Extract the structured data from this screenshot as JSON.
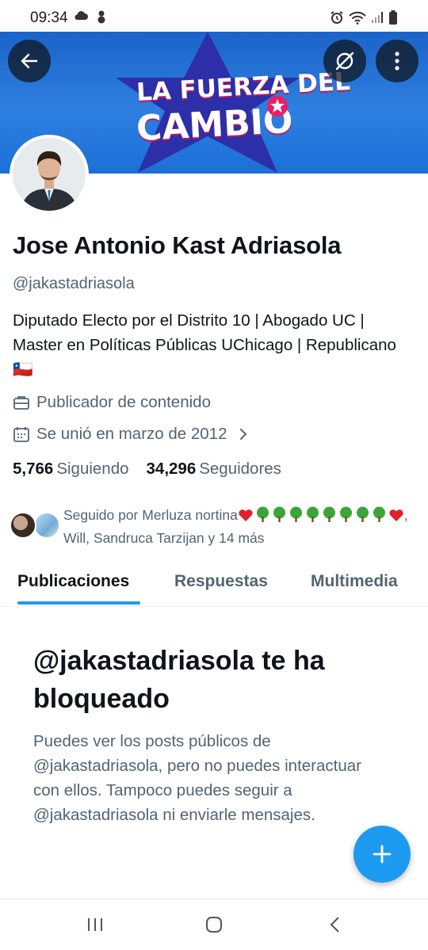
{
  "status_bar": {
    "time": "09:34"
  },
  "banner": {
    "line1": "LA FUERZA DEL",
    "line2": "CAMBIO",
    "colors": {
      "background": "#1b6fd6",
      "star": "#2d2fa8",
      "text": "#ffffff",
      "accent": "#e91e63"
    }
  },
  "profile": {
    "name": "Jose Antonio Kast Adriasola",
    "handle": "@jakastadriasola",
    "bio": "Diputado Electo por el Distrito 10 | Abogado UC | Master en Políticas Públicas UChicago | Republicano 🇨🇱",
    "category": "Publicador de contenido",
    "joined": "Se unió en marzo de 2012",
    "following_count": "5,766",
    "following_label": "Siguiendo",
    "followers_count": "34,296",
    "followers_label": "Seguidores",
    "followed_by_prefix": "Seguido por Merluza nortina",
    "followed_by_suffix": ", Will, Sandruca Tarzijan y 14 más"
  },
  "tabs": [
    {
      "label": "Publicaciones",
      "active": true
    },
    {
      "label": "Respuestas",
      "active": false
    },
    {
      "label": "Multimedia",
      "active": false
    }
  ],
  "blocked": {
    "title": "@jakastadriasola te ha bloqueado",
    "text": "Puedes ver los posts públicos de @jakastadriasola, pero no puedes interactuar con ellos. Tampoco puedes seguir a @jakastadriasola ni enviarle mensajes."
  },
  "icons": {
    "back": "arrow-left-icon",
    "grok": "grok-icon",
    "more": "more-vertical-icon",
    "briefcase": "briefcase-icon",
    "calendar": "calendar-icon",
    "compose": "plus-icon"
  },
  "accent_color": "#1d9bf0"
}
